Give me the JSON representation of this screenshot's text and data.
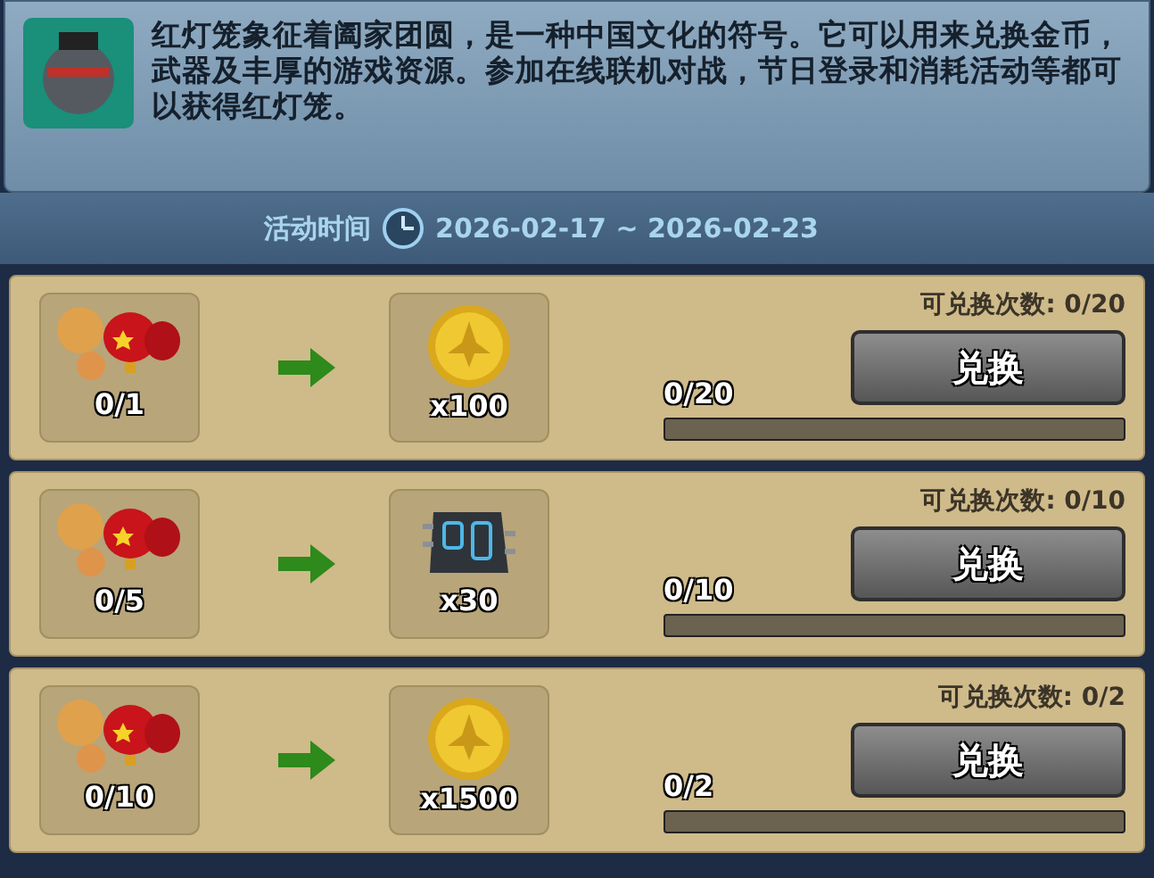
{
  "description": "红灯笼象征着阖家团圆，是一种中国文化的符号。它可以用来兑换金币，武器及丰厚的游戏资源。参加在线联机对战，节日登录和消耗活动等都可以获得红灯笼。",
  "event_time": {
    "label": "活动时间",
    "range": "2026-02-17 ~ 2026-02-23"
  },
  "exchanges": [
    {
      "cost": "0/1",
      "kind": "coin",
      "reward_amount": "x100",
      "remaining": "可兑换次数: 0/20",
      "progress": "0/20",
      "level": 0,
      "button": "兑换"
    },
    {
      "cost": "0/5",
      "kind": "chip",
      "reward_amount": "x30",
      "remaining": "可兑换次数: 0/10",
      "progress": "0/10",
      "level": 0,
      "button": "兑换"
    },
    {
      "cost": "0/10",
      "kind": "coin",
      "reward_amount": "x1500",
      "remaining": "可兑换次数: 0/2",
      "progress": "0/2",
      "level": 0,
      "button": "兑换"
    }
  ]
}
